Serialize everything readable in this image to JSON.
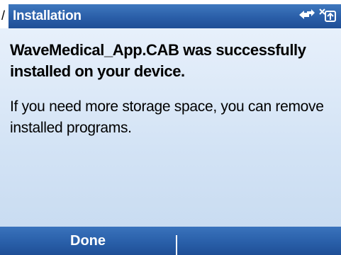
{
  "window": {
    "crumb": "/",
    "title": "Installation",
    "status_icons": [
      "connectivity-icon",
      "sync-icon"
    ]
  },
  "message": {
    "headline": "WaveMedical_App.CAB was successfully installed on your device.",
    "body": "If you need more storage space, you can remove installed programs."
  },
  "softkeys": {
    "left_label": "Done",
    "right_label": ""
  }
}
